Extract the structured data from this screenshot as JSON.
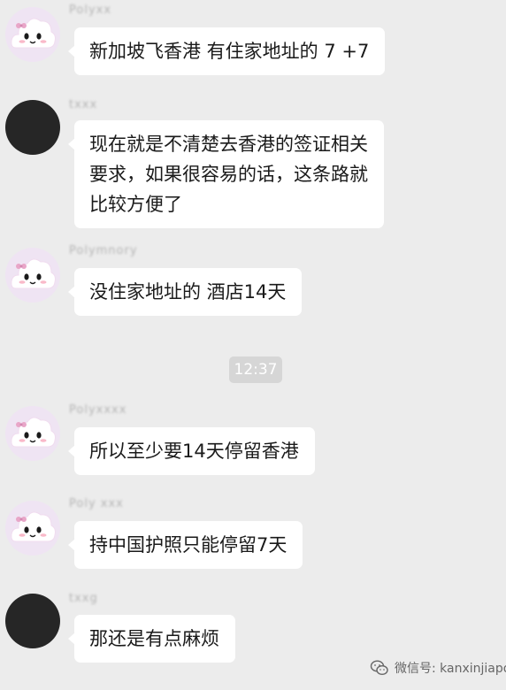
{
  "messages": [
    {
      "sender": "Polyxx",
      "text_lines": [
        "新加坡飞香港 有住家地址的 7 +7"
      ]
    },
    {
      "sender": "txxx",
      "text_lines": [
        "现在就是不清楚去香港的签证相关",
        "要求，如果很容易的话，这条路就",
        "比较方便了"
      ]
    },
    {
      "sender": "Polymnory",
      "text_lines": [
        "没住家地址的 酒店14天"
      ]
    },
    {
      "sender": "Polyxxxx",
      "text_lines": [
        "所以至少要14天停留香港"
      ]
    },
    {
      "sender": "Poly xxx",
      "text_lines": [
        "持中国护照只能停留7天"
      ]
    },
    {
      "sender": "txxg",
      "text_lines": [
        "那还是有点麻烦"
      ]
    }
  ],
  "timestamp": "12:37",
  "watermark": {
    "prefix": "微信号:",
    "account": " kanxinjiapo"
  },
  "colors": {
    "background": "#ececec",
    "bubble": "#ffffff",
    "time_chip": "#d6d6d6"
  }
}
